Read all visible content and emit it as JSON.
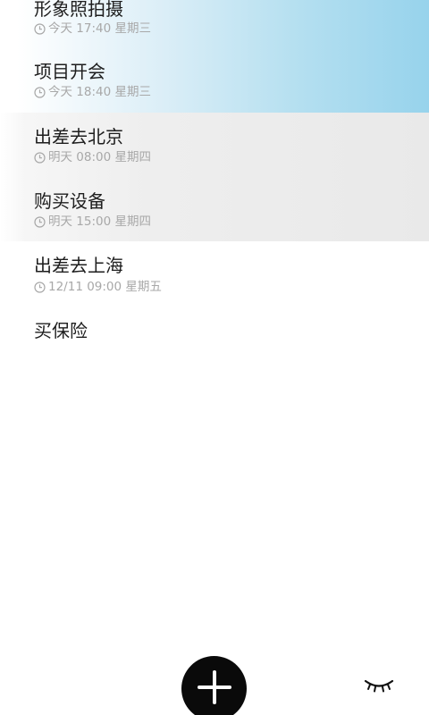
{
  "tasks": [
    {
      "title": "形象照拍摄",
      "icon": "clock-icon",
      "time": "今天 17:40 星期三"
    },
    {
      "title": "项目开会",
      "icon": "clock-icon",
      "time": "今天 18:40 星期三"
    },
    {
      "title": "出差去北京",
      "icon": "clock-icon",
      "time": "明天 08:00 星期四"
    },
    {
      "title": "购买设备",
      "icon": "clock-icon",
      "time": "明天 15:00 星期四"
    },
    {
      "title": "出差去上海",
      "icon": "clock-icon",
      "time": "12/11 09:00 星期五"
    },
    {
      "title": "买保险"
    }
  ],
  "bottom_bar": {
    "add_icon": "plus-icon",
    "visibility_icon": "eye-closed-icon"
  },
  "colors": {
    "today_gradient_end": "#97d3ec",
    "tomorrow_background": "#e9e9e9",
    "title_text": "#1e1e1e",
    "meta_text": "#a8a8a8",
    "fab_background": "#0a0a0a"
  }
}
